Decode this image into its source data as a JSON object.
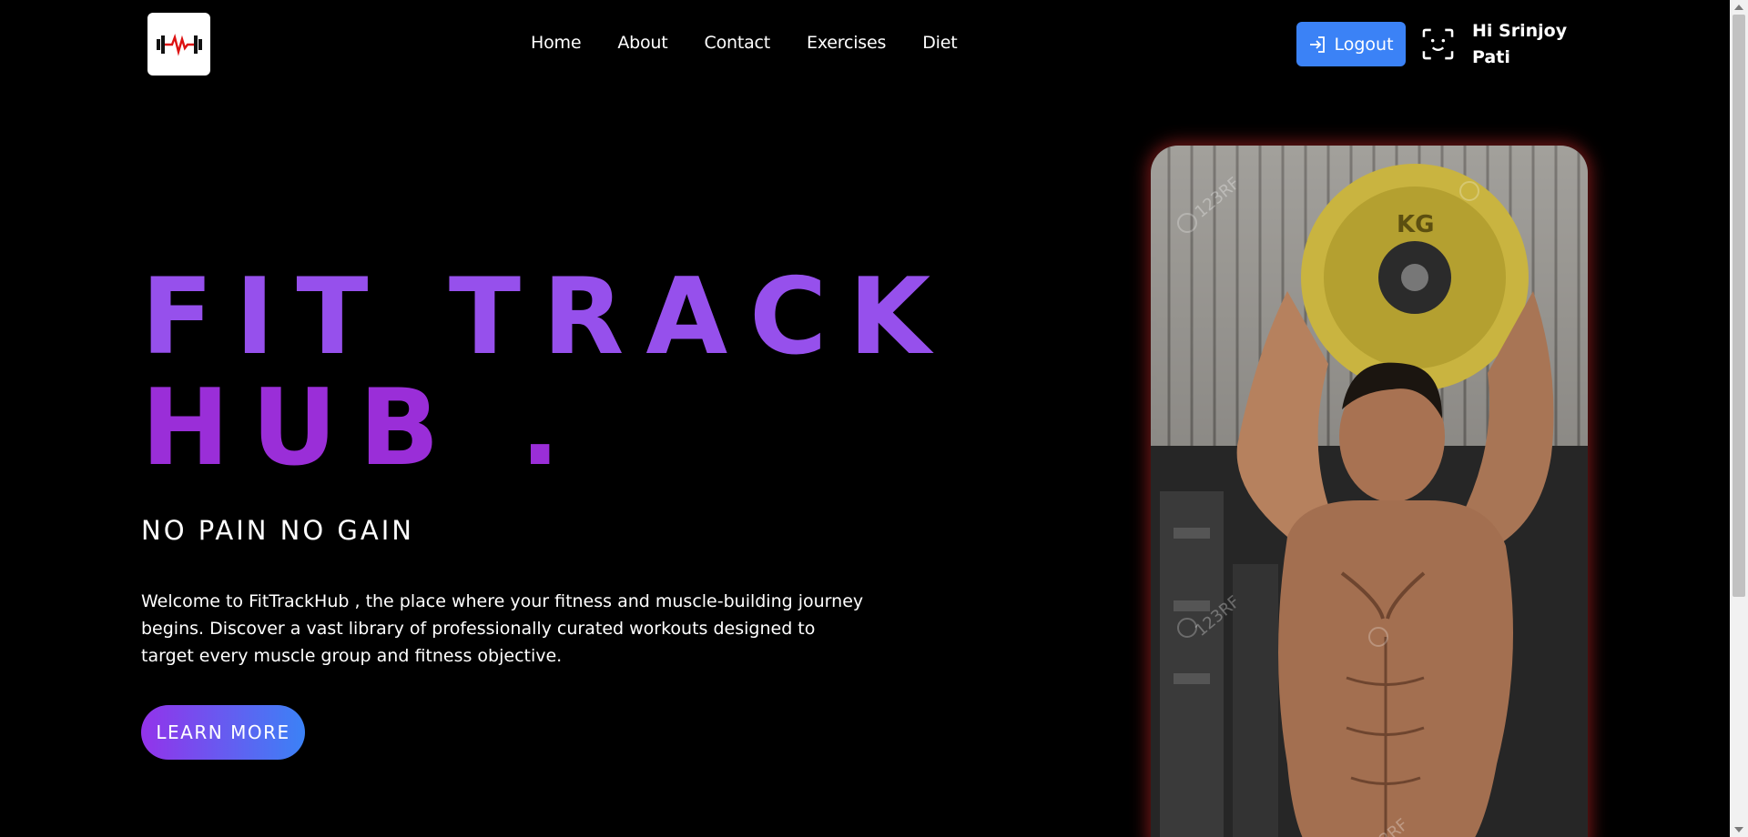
{
  "nav": {
    "logo_icon": "heartbeat-dumbbell-icon",
    "links": [
      {
        "label": "Home"
      },
      {
        "label": "About"
      },
      {
        "label": "Contact"
      },
      {
        "label": "Exercises"
      },
      {
        "label": "Diet"
      }
    ],
    "logout_label": "Logout",
    "logout_icon": "sign-in-arrow-icon",
    "user_icon": "face-scan-icon",
    "greeting": "Hi Srinjoy Pati"
  },
  "hero": {
    "title_line1": "FIT TRACK",
    "title_line2": "HUB .",
    "tagline": "NO PAIN NO GAIN",
    "description": "Welcome to FitTrackHub , the place where your fitness and muscle-building journey begins. Discover a vast library of professionally curated workouts designed to target every muscle group and fitness objective.",
    "cta_label": "LEARN MORE",
    "image_subject": "muscular-man-lifting-weight-plate-photo",
    "watermark": "123RF"
  },
  "colors": {
    "background": "#000000",
    "title_purple": "#9650ec",
    "logout_blue": "#3b82f6",
    "cta_gradient_start": "#9333ea",
    "cta_gradient_end": "#3b82f6",
    "image_glow": "#c82828"
  }
}
